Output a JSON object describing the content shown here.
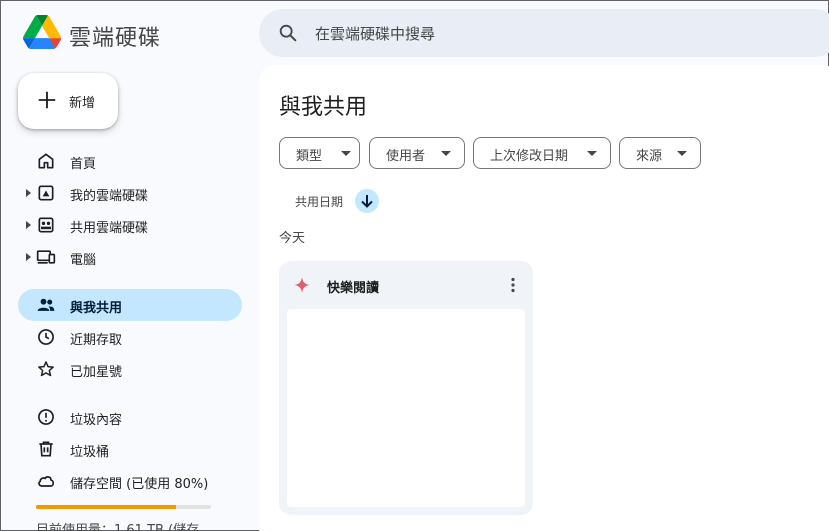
{
  "app": {
    "title": "雲端硬碟"
  },
  "search": {
    "placeholder": "在雲端硬碟中搜尋"
  },
  "new_button": {
    "label": "新增"
  },
  "sidebar": {
    "items": [
      {
        "label": "首頁",
        "icon": "home-icon"
      },
      {
        "label": "我的雲端硬碟",
        "icon": "my-drive-icon"
      },
      {
        "label": "共用雲端硬碟",
        "icon": "shared-drives-icon"
      },
      {
        "label": "電腦",
        "icon": "computers-icon"
      },
      {
        "label": "與我共用",
        "icon": "people-icon",
        "active": true
      },
      {
        "label": "近期存取",
        "icon": "clock-icon"
      },
      {
        "label": "已加星號",
        "icon": "star-icon"
      },
      {
        "label": "垃圾內容",
        "icon": "spam-icon"
      },
      {
        "label": "垃圾桶",
        "icon": "trash-icon"
      },
      {
        "label": "儲存空間 (已使用 80%)",
        "icon": "cloud-icon"
      }
    ],
    "storage": {
      "used_fraction": 0.8,
      "text": "目前使用量：1.61 TB (儲存"
    }
  },
  "main": {
    "title": "與我共用",
    "filters": [
      "類型",
      "使用者",
      "上次修改日期",
      "來源"
    ],
    "sort_label": "共用日期",
    "group_label": "今天",
    "files": [
      {
        "name": "快樂閱讀",
        "icon": "sparkle-icon"
      }
    ]
  },
  "colors": {
    "accent": "#c2e7ff",
    "storage_fill": "#f29900",
    "sparkle": "#e06070"
  }
}
